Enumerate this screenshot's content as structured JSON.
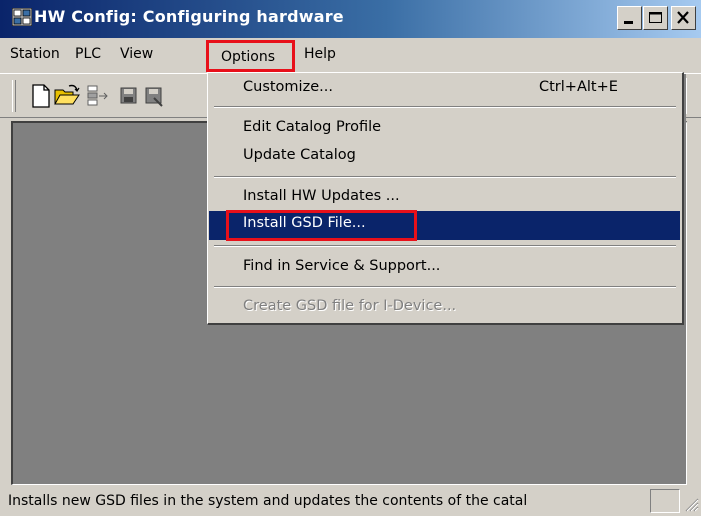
{
  "window": {
    "title": "HW Config: Configuring hardware",
    "accent": "#0a246a",
    "highlight_color": "#e8101a",
    "icons": [
      "app-icon",
      "minimize-icon",
      "maximize-icon",
      "close-icon"
    ]
  },
  "menubar": {
    "items": [
      {
        "label": "Station"
      },
      {
        "label": "PLC"
      },
      {
        "label": "View"
      },
      {
        "label": "Options",
        "state": "open"
      },
      {
        "label": "Help"
      }
    ]
  },
  "toolbar": {
    "icons": [
      "new-icon",
      "open-icon",
      "network-icon",
      "save-icon",
      "save-compile-icon",
      "help-pointer-icon"
    ]
  },
  "options_menu": {
    "items": [
      {
        "label": "Customize...",
        "shortcut": "Ctrl+Alt+E"
      },
      {
        "label": "Edit Catalog Profile"
      },
      {
        "label": "Update Catalog"
      },
      {
        "label": "Install HW Updates ..."
      },
      {
        "label": "Install GSD File...",
        "state": "selected"
      },
      {
        "label": "Find in Service & Support..."
      },
      {
        "label": "Create GSD file for I-Device...",
        "state": "disabled"
      }
    ]
  },
  "statusbar": {
    "text": "Installs new GSD files in the system and updates the contents of the catal"
  }
}
